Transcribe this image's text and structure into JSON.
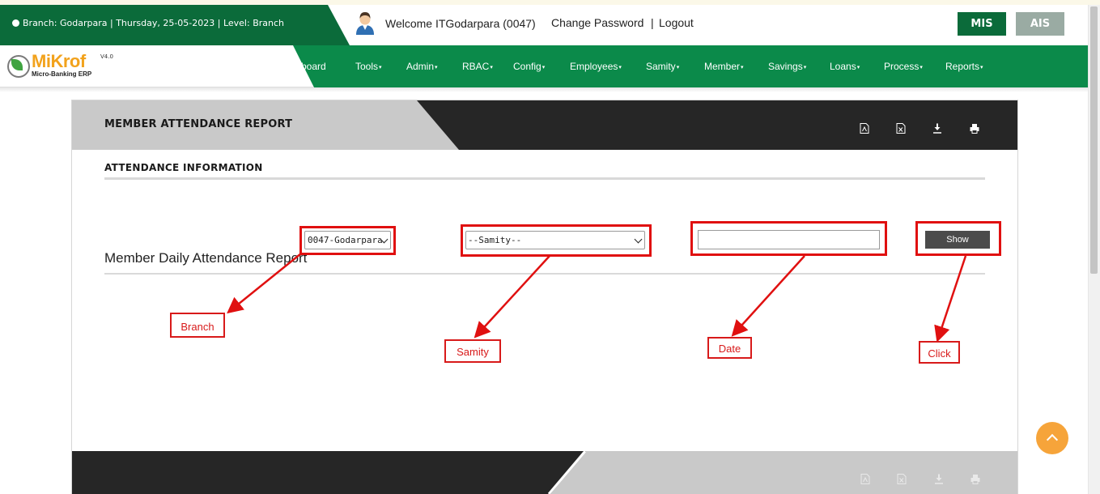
{
  "header": {
    "branch_info": "Branch: Godarpara | Thursday, 25-05-2023 | Level: Branch",
    "welcome": "Welcome ITGodarpara (0047)",
    "change_password": "Change Password",
    "separator": "|",
    "logout": "Logout",
    "mis_label": "MIS",
    "ais_label": "AIS"
  },
  "logo": {
    "name": "MiKrof",
    "version": "V4.0",
    "tagline": "Micro-Banking ERP"
  },
  "nav": {
    "items": [
      "board",
      "Tools",
      "Admin",
      "RBAC",
      "Config",
      "Employees",
      "Samity",
      "Member",
      "Savings",
      "Loans",
      "Process",
      "Reports"
    ]
  },
  "panel": {
    "title": "MEMBER ATTENDANCE REPORT",
    "section_title": "ATTENDANCE INFORMATION",
    "report_title": "Member Daily Attendance Report",
    "header_icons": [
      "pdf-icon",
      "excel-icon",
      "download-icon",
      "print-icon"
    ]
  },
  "form": {
    "branch_value": "0047-Godarpara",
    "samity_value": "--Samity--",
    "date_value": "",
    "show_label": "Show"
  },
  "callouts": {
    "branch": "Branch",
    "samity": "Samity",
    "date": "Date",
    "click": "Click"
  },
  "colors": {
    "brand_green": "#0b8a4a",
    "dark_green": "#0b6b3a",
    "annotation_red": "#e01010",
    "scroll_top": "#f6a43a"
  }
}
